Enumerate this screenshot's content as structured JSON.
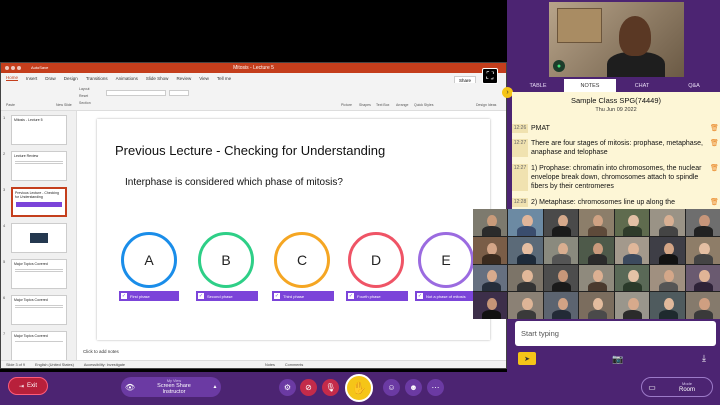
{
  "ppt": {
    "autosave": "AutoSave",
    "title": "Mitosis - Lecture 5",
    "menu": [
      "Home",
      "Insert",
      "Draw",
      "Design",
      "Transitions",
      "Animations",
      "Slide Show",
      "Review",
      "View",
      "Tell me"
    ],
    "share": "Share",
    "ribbon_groups": [
      "Paste",
      "New Slide",
      "Layout",
      "Reset",
      "Section",
      "Picture",
      "Shapes",
      "Text Box",
      "Arrange",
      "Quick Styles",
      "Design Ideas"
    ],
    "slide_numbers": [
      "1",
      "2",
      "3",
      "4",
      "5",
      "6",
      "7"
    ],
    "thumb_titles": [
      "Mitosis - Lecture 5",
      "Lecture Review",
      "Previous Lecture - Checking for Understanding",
      "",
      "Major Topics Covered",
      "Major Topics Covered",
      "Major Topics Covered"
    ],
    "slide_title": "Previous Lecture - Checking for Understanding",
    "question": "Interphase is considered which phase of mitosis?",
    "options": [
      {
        "letter": "A",
        "label": "First phase",
        "color": "#1a8de9"
      },
      {
        "letter": "B",
        "label": "Second phase",
        "color": "#2ecf87"
      },
      {
        "letter": "C",
        "label": "Third phase",
        "color": "#f5a623"
      },
      {
        "letter": "D",
        "label": "Fourth phase",
        "color": "#ef5466"
      },
      {
        "letter": "E",
        "label": "Not a phase of mitosis",
        "color": "#9b6be0"
      }
    ],
    "notes_placeholder": "Click to add notes",
    "status": [
      "Slide 3 of 9",
      "English (United States)",
      "Accessibility: Investigate",
      "Notes",
      "Comments"
    ]
  },
  "panel": {
    "tabs": [
      "TABLE",
      "NOTES",
      "CHAT",
      "Q&A"
    ],
    "notes_title": "Sample Class SPG(74449)",
    "notes_date": "Thu Jun 09 2022",
    "notes": [
      {
        "time": "12:26",
        "text": "PMAT"
      },
      {
        "time": "12:27",
        "text": "There are four stages of mitosis: prophase, metaphase, anaphase and telophase"
      },
      {
        "time": "12:27",
        "text": "1) Prophase: chromatin into chromosomes, the nuclear envelope break down, chromosomes attach to spindle fibers by their centromeres"
      },
      {
        "time": "12:28",
        "text": "2) Metaphase: chromosomes line up along the"
      }
    ],
    "input_placeholder": "Start typing"
  },
  "toolbar": {
    "exit": "Exit",
    "my_view_label": "My View",
    "my_view_value_1": "Screen Share",
    "my_view_value_2": "Instructor",
    "mode_label": "Mode",
    "mode_value": "Room"
  },
  "colors": {
    "panel": "#4c2472",
    "accent": "#f5c518",
    "ppt": "#c43e1c"
  }
}
